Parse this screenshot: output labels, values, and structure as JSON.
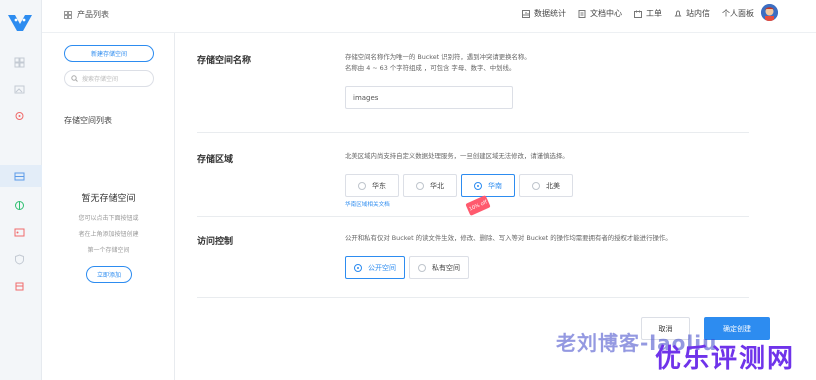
{
  "topbar": {
    "breadcrumb": "产品列表",
    "nav": [
      {
        "icon": "chart-icon",
        "label": "数据统计"
      },
      {
        "icon": "doc-icon",
        "label": "文档中心"
      },
      {
        "icon": "ticket-icon",
        "label": "工单"
      },
      {
        "icon": "bell-icon",
        "label": "站内信"
      }
    ],
    "profile_label": "个人面板"
  },
  "left_panel": {
    "new_button": "新建存储空间",
    "search_placeholder": "搜索存储空间",
    "list_title": "存储空间列表",
    "empty_title": "暂无存储空间",
    "empty_lines": [
      "您可以点击下面按钮或",
      "者在上角添加按钮创建",
      "第一个存储空间"
    ],
    "add_button": "立即添加"
  },
  "form": {
    "name": {
      "label": "存储空间名称",
      "desc_line1": "存储空间名称作为唯一的 Bucket 识别符，遇到冲突请更换名称。",
      "desc_line2": "名称由 4 ~ 63 个字符组成 ，可包含 字母、数字、中划线。",
      "value": "images"
    },
    "region": {
      "label": "存储区域",
      "desc": "北美区域内尚支持自定义数据处理服务，一旦创建区域无法修改，请谨慎选择。",
      "options": [
        "华东",
        "华北",
        "华南",
        "北美"
      ],
      "selected": "华南",
      "doc_link": "华南区域相关文档",
      "tag": "10% off"
    },
    "access": {
      "label": "访问控制",
      "desc": "公开和私有仅对 Bucket 的读文件生效，修改、删除、写入等对 Bucket 的操作均需要拥有者的授权才能进行操作。",
      "options": [
        "公开空间",
        "私有空间"
      ],
      "selected": "公开空间"
    },
    "cancel": "取消",
    "confirm": "确定创建"
  },
  "watermark": {
    "line1": "老刘博客-laoliu",
    "line2": "优乐评测网"
  },
  "colors": {
    "accent": "#2d8cf0",
    "tag": "#ff5a6e",
    "watermark": "#6f33ea"
  }
}
